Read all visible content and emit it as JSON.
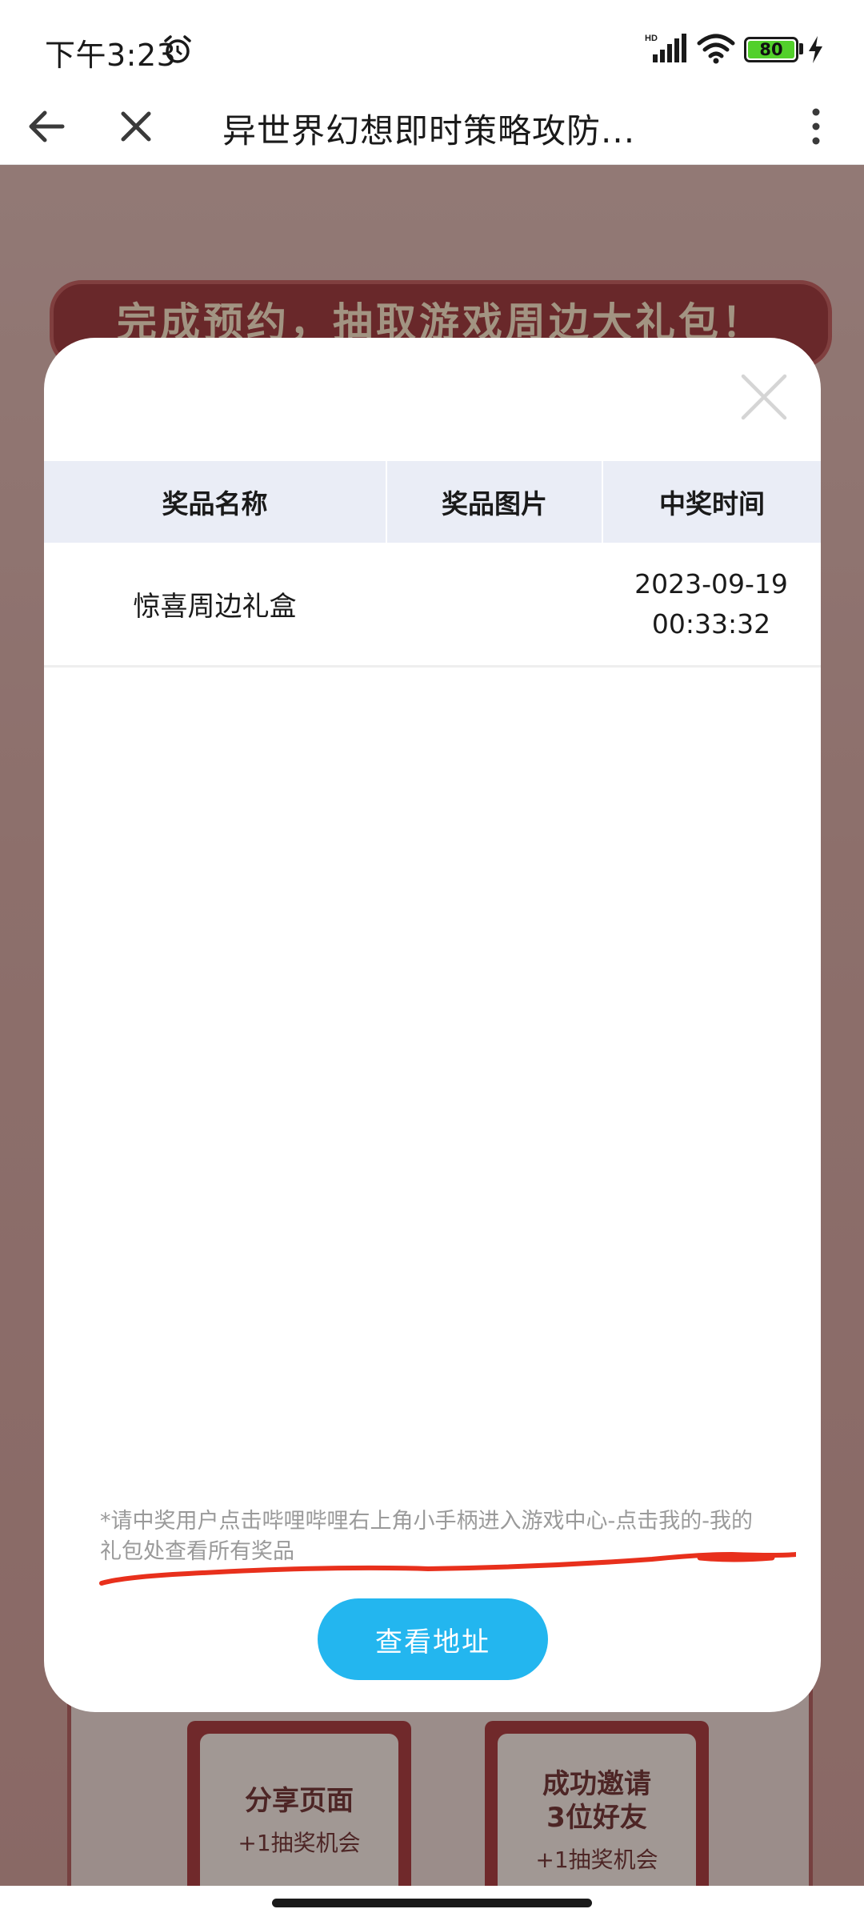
{
  "status_bar": {
    "time": "下午3:23",
    "battery_level": "80",
    "network_label": "HD"
  },
  "browser": {
    "title": "异世界幻想即时策略攻防..."
  },
  "background_page": {
    "banner_text": "完成预约，抽取游戏周边大礼包！",
    "tasks": [
      {
        "name": "分享页面",
        "reward": "+1抽奖机会"
      },
      {
        "name": "成功邀请\n3位好友",
        "reward": "+1抽奖机会"
      }
    ]
  },
  "prize_modal": {
    "columns": [
      "奖品名称",
      "奖品图片",
      "中奖时间"
    ],
    "rows": [
      {
        "name": "惊喜周边礼盒",
        "image": "",
        "date": "2023-09-19",
        "time": "00:33:32"
      }
    ],
    "notice": "*请中奖用户点击哔哩哔哩右上角小手柄进入游戏中心-点击我的-我的礼包处查看所有奖品",
    "button_label": "查看地址"
  },
  "colors": {
    "button": "#23b6ef",
    "table_header_bg": "#eaedf6",
    "annotation_stroke": "#e8301c",
    "battery_fill": "#52d02b"
  }
}
